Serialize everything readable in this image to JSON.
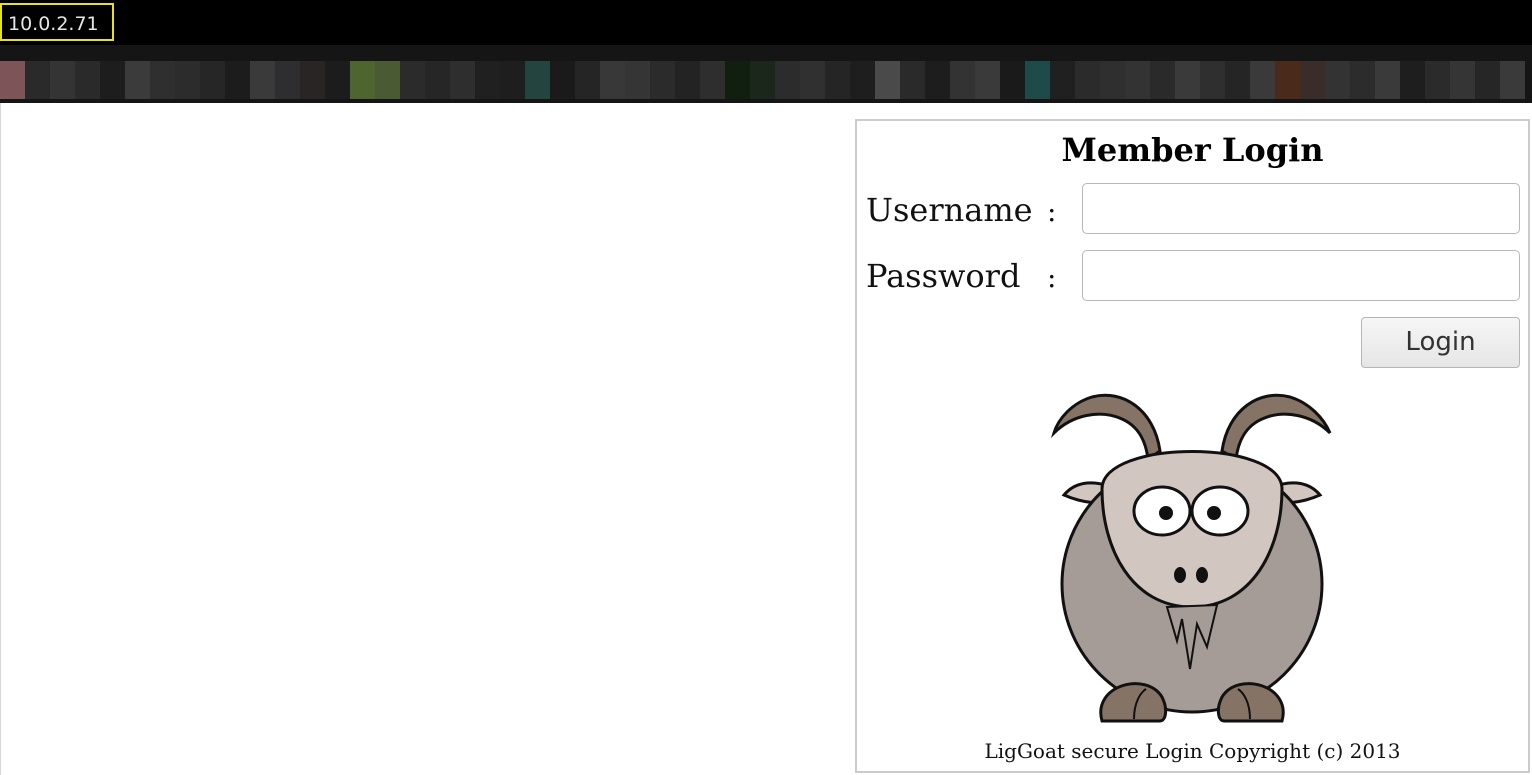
{
  "top_bar": {
    "host": "10.0.2.71"
  },
  "login": {
    "title": "Member Login",
    "username_label": "Username",
    "password_label": "Password",
    "colon": ":",
    "username_value": "",
    "password_value": "",
    "button_label": "Login",
    "footer": "LigGoat secure Login Copyright (c) 2013"
  },
  "mascot": {
    "icon": "goat-icon"
  },
  "colors": {
    "highlight_border": "#e8e21a",
    "goat_body": "#d2c7c0",
    "goat_horns": "#857366"
  }
}
